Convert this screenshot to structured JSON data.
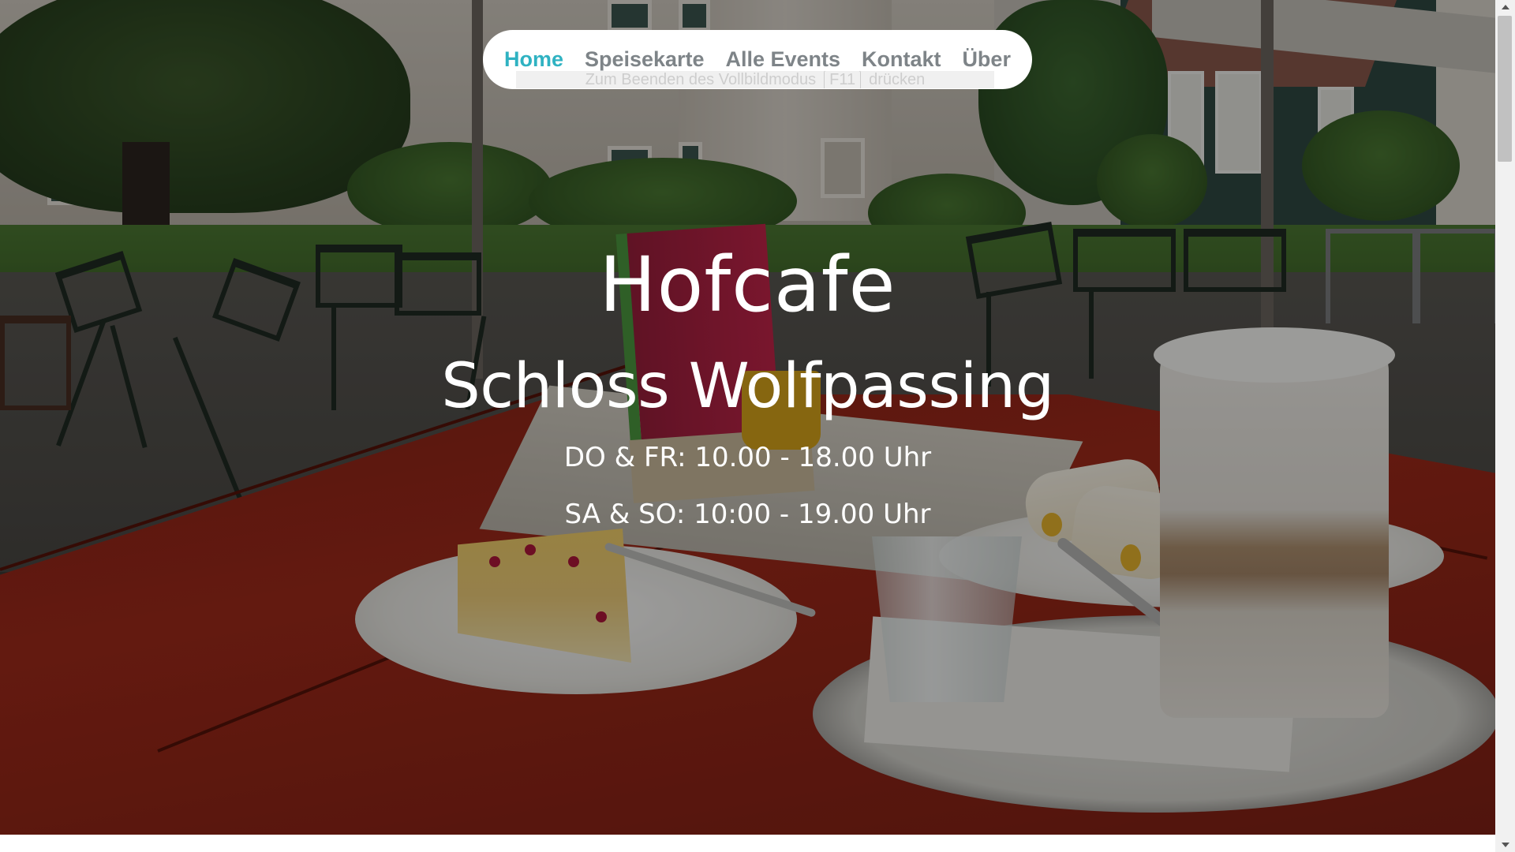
{
  "nav": {
    "items": [
      {
        "label": "Home",
        "active": true
      },
      {
        "label": "Speisekarte",
        "active": false
      },
      {
        "label": "Alle Events",
        "active": false
      },
      {
        "label": "Kontakt",
        "active": false
      },
      {
        "label": "Über",
        "active": false
      }
    ],
    "accent_color": "#2fb2c2",
    "inactive_color": "#7e8488"
  },
  "fullscreen_hint": {
    "text_before": "Zum Beenden des Vollbildmodus",
    "key": "F11",
    "text_after": "drücken"
  },
  "hero": {
    "title": "Hofcafe",
    "subtitle": "Schloss Wolfpassing",
    "hours": [
      "DO & FR: 10.00 - 18.00 Uhr",
      "SA & SO: 10:00 - 19.00 Uhr"
    ],
    "background_image": "cafe-terrace-photo"
  },
  "scrollbar": {
    "icons": [
      "scroll-up-arrow-icon",
      "scroll-down-arrow-icon"
    ]
  }
}
